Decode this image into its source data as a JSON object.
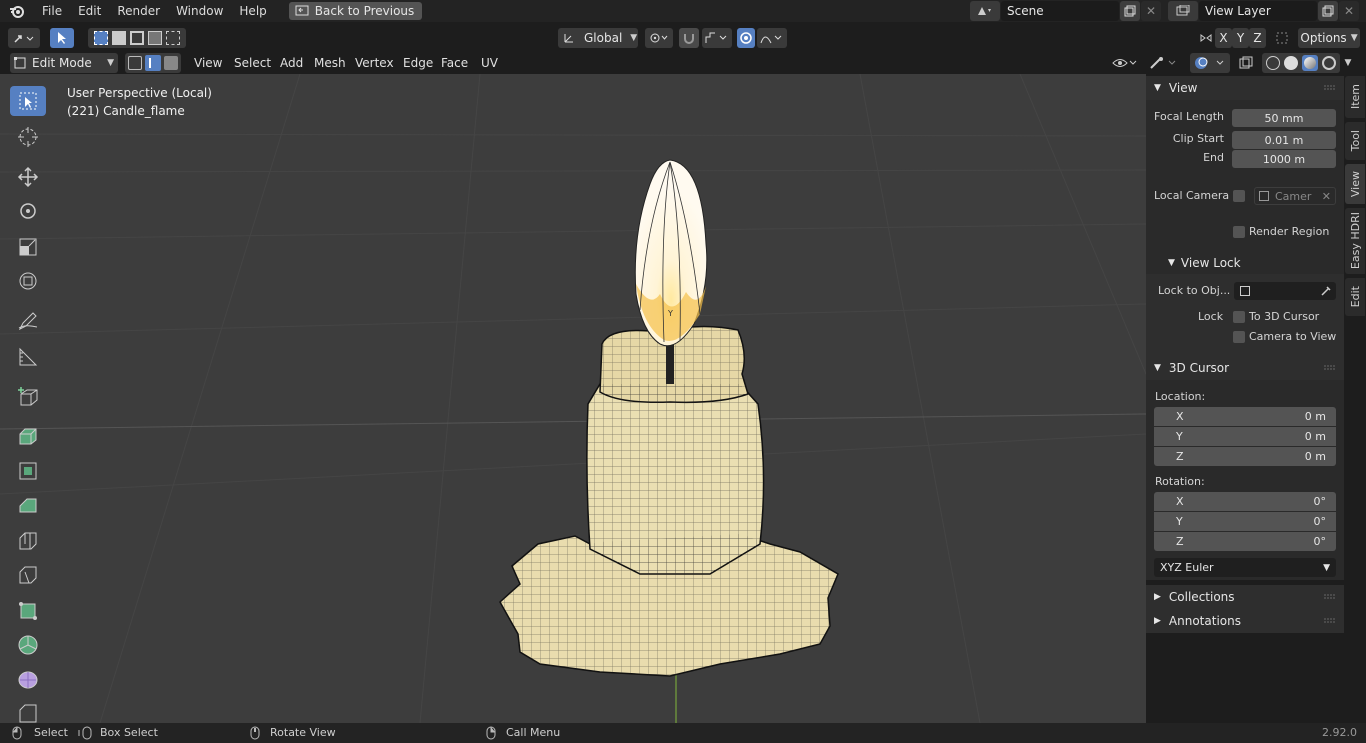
{
  "topbar": {
    "menus": [
      "File",
      "Edit",
      "Render",
      "Window",
      "Help"
    ],
    "back_label": "Back to Previous",
    "scene_name": "Scene",
    "view_layer": "View Layer"
  },
  "toolbar": {
    "orientation": "Global",
    "axes": [
      "X",
      "Y",
      "Z"
    ],
    "options_label": "Options"
  },
  "modebar": {
    "mode": "Edit Mode",
    "menus": [
      "View",
      "Select",
      "Add",
      "Mesh",
      "Vertex",
      "Edge",
      "Face",
      "UV"
    ]
  },
  "viewport": {
    "perspective": "User Perspective (Local)",
    "object": "(221) Candle_flame"
  },
  "sidebar": {
    "view_panel": {
      "title": "View",
      "focal_length_label": "Focal Length",
      "focal_length": "50 mm",
      "clip_start_label": "Clip Start",
      "clip_start": "0.01 m",
      "end_label": "End",
      "end": "1000 m",
      "local_camera_label": "Local Camera",
      "camera_placeholder": "Camer",
      "render_region": "Render Region"
    },
    "view_lock": {
      "title": "View Lock",
      "lock_to_obj_label": "Lock to Obj...",
      "lock_label": "Lock",
      "to_3d_cursor": "To 3D Cursor",
      "camera_to_view": "Camera to View"
    },
    "cursor_panel": {
      "title": "3D Cursor",
      "location_label": "Location:",
      "location": [
        {
          "axis": "X",
          "value": "0 m"
        },
        {
          "axis": "Y",
          "value": "0 m"
        },
        {
          "axis": "Z",
          "value": "0 m"
        }
      ],
      "rotation_label": "Rotation:",
      "rotation": [
        {
          "axis": "X",
          "value": "0°"
        },
        {
          "axis": "Y",
          "value": "0°"
        },
        {
          "axis": "Z",
          "value": "0°"
        }
      ],
      "rotation_mode": "XYZ Euler"
    },
    "collections_title": "Collections",
    "annotations_title": "Annotations"
  },
  "tabs": [
    "Item",
    "Tool",
    "View",
    "Easy HDRI",
    "Edit"
  ],
  "statusbar": {
    "select": "Select",
    "box_select": "Box Select",
    "rotate_view": "Rotate View",
    "call_menu": "Call Menu",
    "version": "2.92.0"
  },
  "colors": {
    "accent": "#5680c2",
    "viewport_bg": "#3d3d3d",
    "wax": "#e8d9a8",
    "flame": "#fff8e6"
  }
}
